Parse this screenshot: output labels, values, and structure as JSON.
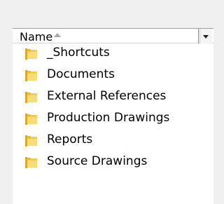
{
  "header": {
    "column_name": "Name"
  },
  "items": [
    {
      "label": "_Shortcuts",
      "icon": "folder-icon"
    },
    {
      "label": "Documents",
      "icon": "folder-icon"
    },
    {
      "label": "External References",
      "icon": "folder-icon"
    },
    {
      "label": "Production Drawings",
      "icon": "folder-icon"
    },
    {
      "label": "Reports",
      "icon": "folder-icon"
    },
    {
      "label": "Source Drawings",
      "icon": "folder-icon"
    }
  ],
  "colors": {
    "folder_yellow": "#f2cc4f",
    "folder_shadow": "#d9a927"
  }
}
